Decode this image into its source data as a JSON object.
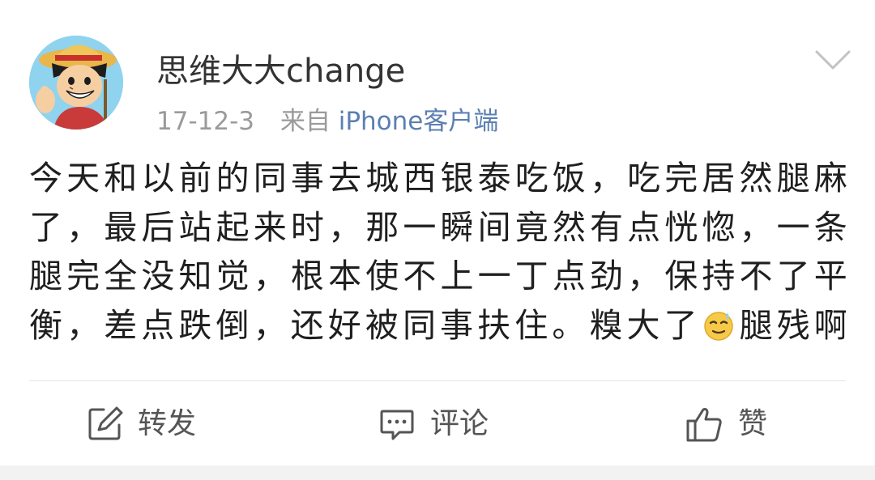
{
  "post": {
    "username": "思维大大change",
    "time": "17-12-3",
    "source_prefix": "来自",
    "source": "iPhone客户端",
    "text_lines": [
      "今天和以前的同事去城西银泰吃饭，吃完居然腿麻",
      "了，最后站起来时，那一瞬间竟然有点恍惚，一条",
      "腿完全没知觉，根本使不上一丁点劲，保持不了平",
      "衡，差点跌倒，还好被同事扶住。糗大了"
    ],
    "text_tail": "腿残啊",
    "emoji_icon": "sweat-smile-emoji-icon"
  },
  "actions": {
    "repost_label": "转发",
    "comment_label": "评论",
    "like_label": "赞"
  },
  "colors": {
    "source_link": "#5b7fb2",
    "meta_gray": "#9a9a9a",
    "action_gray": "#555555"
  }
}
